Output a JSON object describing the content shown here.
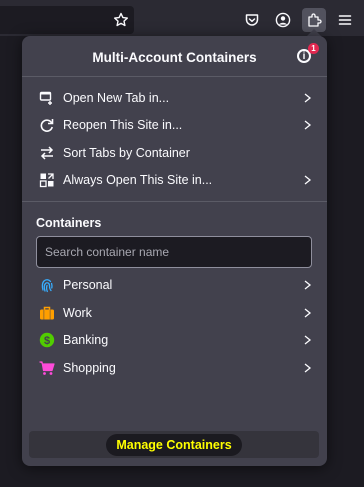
{
  "panel": {
    "title": "Multi-Account Containers",
    "info_badge": "1",
    "info_glyph": "i"
  },
  "menu": [
    {
      "label": "Open New Tab in...",
      "icon": "new-tab-icon",
      "has_submenu": true
    },
    {
      "label": "Reopen This Site in...",
      "icon": "reopen-icon",
      "has_submenu": true
    },
    {
      "label": "Sort Tabs by Container",
      "icon": "sort-icon",
      "has_submenu": false
    },
    {
      "label": "Always Open This Site in...",
      "icon": "always-open-icon",
      "has_submenu": true
    }
  ],
  "containers": {
    "heading": "Containers",
    "search_placeholder": "Search container name",
    "items": [
      {
        "label": "Personal",
        "icon": "fingerprint-icon",
        "color": "#37adff"
      },
      {
        "label": "Work",
        "icon": "briefcase-icon",
        "color": "#ff9f00"
      },
      {
        "label": "Banking",
        "icon": "dollar-icon",
        "color": "#51cd00"
      },
      {
        "label": "Shopping",
        "icon": "cart-icon",
        "color": "#ff4bda"
      }
    ]
  },
  "footer": {
    "manage_label": "Manage Containers",
    "highlight_color": "#ffff00"
  }
}
